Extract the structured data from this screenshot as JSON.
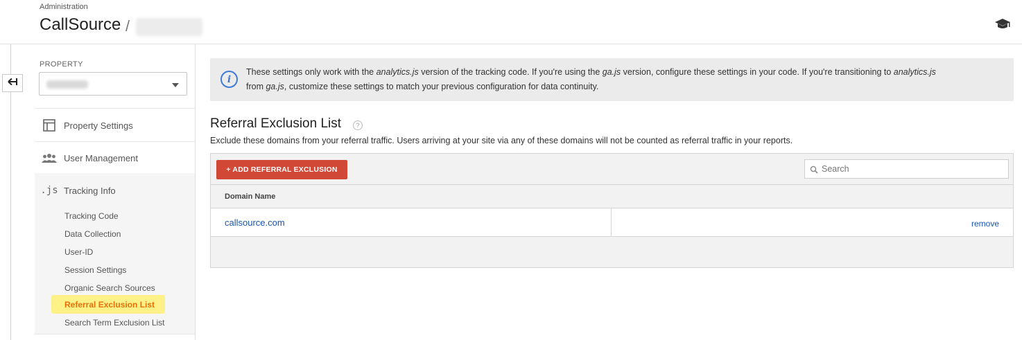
{
  "header": {
    "breadcrumb": "Administration",
    "account_name": "CallSource",
    "separator": "/",
    "help_icon": "graduation-cap-icon"
  },
  "rail": {
    "back_icon": "back-arrow-icon"
  },
  "sidebar": {
    "property_label": "PROPERTY",
    "items": [
      {
        "label": "Property Settings",
        "icon": "layout-icon"
      },
      {
        "label": "User Management",
        "icon": "people-icon"
      },
      {
        "label": "Tracking Info",
        "icon": ".js"
      }
    ],
    "sub_items": [
      {
        "label": "Tracking Code"
      },
      {
        "label": "Data Collection"
      },
      {
        "label": "User-ID"
      },
      {
        "label": "Session Settings"
      },
      {
        "label": "Organic Search Sources"
      },
      {
        "label": "Referral Exclusion List",
        "active": true
      },
      {
        "label": "Search Term Exclusion List"
      }
    ]
  },
  "info": {
    "icon": "info-icon",
    "line1_pre": "These settings only work with the ",
    "line1_em1": "analytics.js",
    "line1_mid": " version of the tracking code. If you're using the ",
    "line1_em2": "ga.js",
    "line1_post": " version, configure these settings in your code. If you're transitioning to ",
    "line1_em3": "analytics.js",
    "line2_pre": "from ",
    "line2_em": "ga.js",
    "line2_post": ", customize these settings to match your previous configuration for data continuity."
  },
  "section": {
    "title": "Referral Exclusion List",
    "help": "?",
    "description": "Exclude these domains from your referral traffic. Users arriving at your site via any of these domains will not be counted as referral traffic in your reports."
  },
  "table": {
    "add_button": "+ ADD REFERRAL EXCLUSION",
    "search_placeholder": "Search",
    "column_header": "Domain Name",
    "rows": [
      {
        "domain": "callsource.com",
        "action": "remove"
      }
    ]
  },
  "colors": {
    "accent_red": "#d14836",
    "link_blue": "#1a57b0",
    "active_highlight": "#fdf187",
    "active_text": "#e8710a"
  }
}
